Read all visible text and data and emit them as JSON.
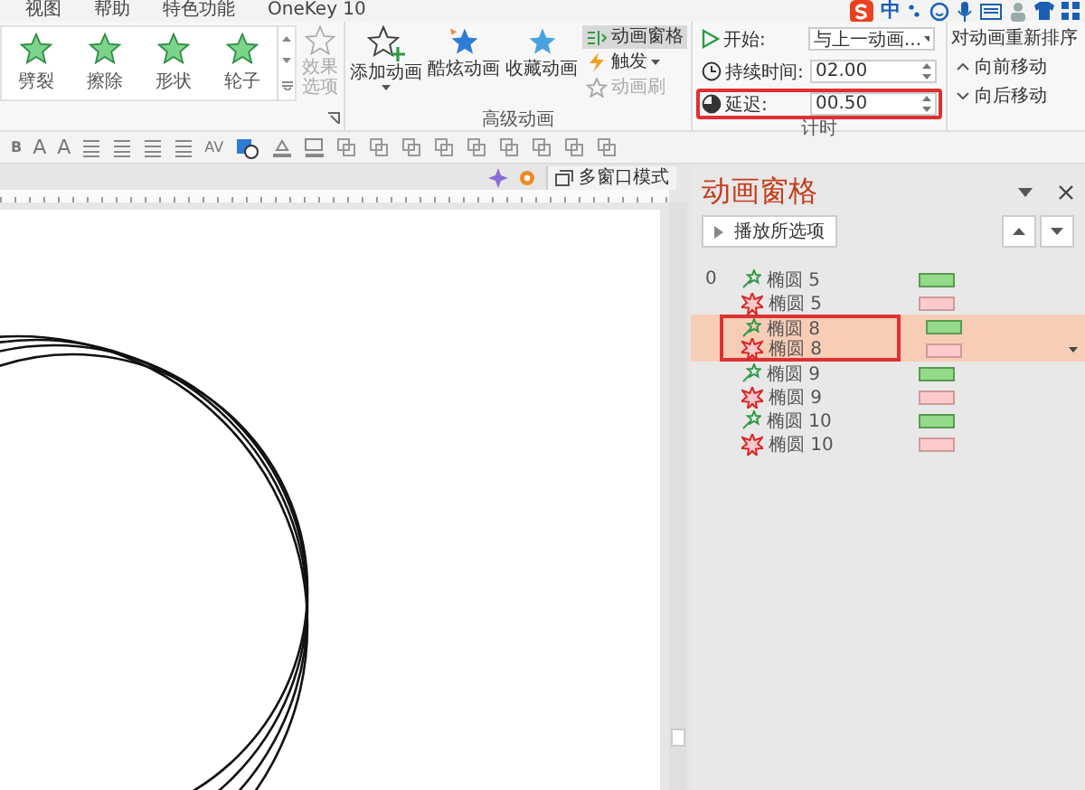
{
  "menu": {
    "tabs": [
      {
        "label": "视图",
        "selected": false
      },
      {
        "label": "帮助",
        "selected": false
      },
      {
        "label": "特色功能",
        "selected": false
      },
      {
        "label": "OneKey 10",
        "selected": false
      }
    ]
  },
  "tray": {
    "ime_label": "中"
  },
  "ribbon": {
    "gallery": [
      {
        "label": "劈裂"
      },
      {
        "label": "擦除"
      },
      {
        "label": "形状"
      },
      {
        "label": "轮子"
      }
    ],
    "effect_options": {
      "label": "效果选项",
      "disabled": true
    },
    "advanced": {
      "title": "高级动画",
      "big_buttons": [
        {
          "label": "添加动画",
          "kind": "add"
        },
        {
          "label": "酷炫动画",
          "kind": "cool"
        },
        {
          "label": "收藏动画",
          "kind": "fav"
        }
      ],
      "small_buttons": [
        {
          "label": "动画窗格",
          "kind": "pane",
          "selected": true,
          "disabled": false
        },
        {
          "label": "触发",
          "kind": "trigger",
          "selected": false,
          "disabled": false
        },
        {
          "label": "动画刷",
          "kind": "brush",
          "selected": false,
          "disabled": true
        }
      ]
    },
    "timing": {
      "title": "计时",
      "start": {
        "label": "开始:",
        "value": "与上一动画..."
      },
      "duration": {
        "label": "持续时间:",
        "value": "02.00",
        "outlined": false
      },
      "delay": {
        "label": "延迟:",
        "value": "00.50",
        "outlined": true
      }
    },
    "reorder": {
      "title": "对动画重新排序",
      "forward": "向前移动",
      "backward": "向后移动"
    }
  },
  "toolbar": {
    "text_buttons": [
      "B",
      "A",
      "A"
    ],
    "spacing_label": "AV"
  },
  "view_bar": {
    "multi_window": "多窗口模式"
  },
  "pane": {
    "title": "动画窗格",
    "play_button": "播放所选项",
    "items": [
      {
        "index": "0",
        "kind": "entrance",
        "name": "椭圆 5",
        "selected": false,
        "outlined": false
      },
      {
        "kind": "exit",
        "name": "椭圆 5",
        "selected": false,
        "outlined": false
      },
      {
        "kind": "entrance",
        "name": "椭圆 8",
        "selected": true,
        "outlined": true
      },
      {
        "kind": "exit",
        "name": "椭圆 8",
        "selected": true,
        "outlined": true
      },
      {
        "kind": "entrance",
        "name": "椭圆 9",
        "selected": false,
        "outlined": false
      },
      {
        "kind": "exit",
        "name": "椭圆 9",
        "selected": false,
        "outlined": false
      },
      {
        "kind": "entrance",
        "name": "椭圆 10",
        "selected": false,
        "outlined": false
      },
      {
        "kind": "exit",
        "name": "椭圆 10",
        "selected": false,
        "outlined": false
      }
    ]
  }
}
